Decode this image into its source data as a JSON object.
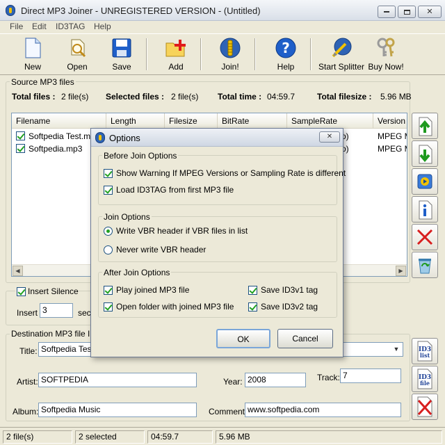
{
  "window": {
    "title": "Direct MP3 Joiner - UNREGISTERED VERSION - (Untitled)",
    "minimize_icon": "minimize-icon",
    "maximize_icon": "maximize-icon",
    "close_glyph": "✕"
  },
  "menu": [
    "File",
    "Edit",
    "ID3TAG",
    "Help"
  ],
  "toolbar": {
    "new": "New",
    "open": "Open",
    "save": "Save",
    "add": "Add",
    "join": "Join!",
    "help": "Help",
    "start_splitter": "Start Splitter",
    "buy_now": "Buy Now!"
  },
  "source": {
    "title": "Source MP3 files",
    "total_files_label": "Total files :",
    "total_files_value": "2 file(s)",
    "selected_files_label": "Selected files :",
    "selected_files_value": "2 file(s)",
    "total_time_label": "Total time :",
    "total_time_value": "04:59.7",
    "total_filesize_label": "Total filesize :",
    "total_filesize_value": "5.96 MB"
  },
  "list": {
    "columns": [
      "Filename",
      "Length",
      "Filesize",
      "BitRate",
      "SampleRate",
      "Version"
    ],
    "rows": [
      {
        "filename": "Softpedia Test.mp3",
        "samplerate_tail": "o)",
        "version": "MPEG M"
      },
      {
        "filename": "Softpedia.mp3",
        "samplerate_tail": "o)",
        "version": "MPEG M"
      }
    ]
  },
  "silence": {
    "checkbox_label": "Insert Silence",
    "insert_label": "Insert",
    "insert_value": "3",
    "sec_label": "sec"
  },
  "destination": {
    "title": "Destination MP3 file ID3",
    "title_label": "Title:",
    "title_value": "Softpedia Test",
    "artist_label": "Artist:",
    "artist_value": "SOFTPEDIA",
    "year_label": "Year:",
    "year_value": "2008",
    "track_label": "Track:",
    "track_value": "7",
    "album_label": "Album:",
    "album_value": "Softpedia Music",
    "comment_label": "Comment:",
    "comment_value": "www.softpedia.com"
  },
  "status": {
    "files": "2 file(s)",
    "selected": "2 selected",
    "time": "04:59.7",
    "size": "5.96 MB"
  },
  "dialog": {
    "title": "Options",
    "before_title": "Before Join Options",
    "show_warning": "Show Warning If MPEG Versions or Sampling Rate is different",
    "load_id3": "Load ID3TAG from first MP3 file",
    "join_title": "Join Options",
    "write_vbr": "Write VBR header if VBR files in list",
    "never_vbr": "Never write VBR header",
    "after_title": "After Join Options",
    "play_joined": "Play joined MP3 file",
    "save_v1": "Save ID3v1 tag",
    "open_folder": "Open folder with joined MP3 file",
    "save_v2": "Save ID3v2 tag",
    "ok": "OK",
    "cancel": "Cancel"
  },
  "icons": {
    "side": [
      "move-up-icon",
      "move-down-icon",
      "play-icon",
      "info-icon",
      "delete-icon",
      "recycle-icon"
    ],
    "id3": [
      "id3-list-icon",
      "id3-file-icon",
      "id3-clear-icon"
    ],
    "id3_list_text": "ID3 list",
    "id3_file_text": "ID3 file"
  },
  "colors": {
    "accent_blue": "#2e63b5",
    "delete_red": "#d81e1e",
    "check_green": "#21a121",
    "toolbar_red": "#e01b1b"
  }
}
